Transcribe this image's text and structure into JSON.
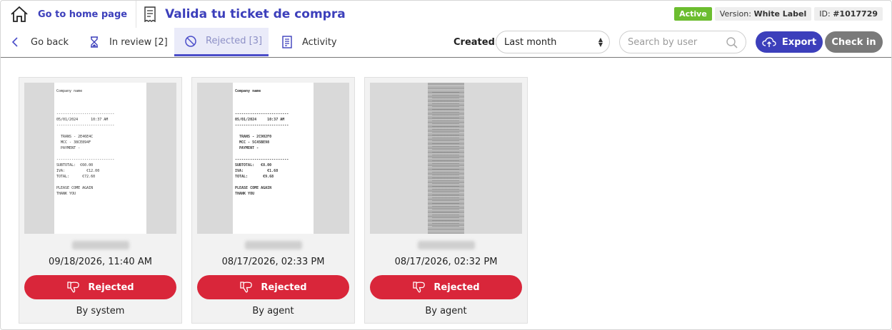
{
  "header": {
    "home_label": "Go to home page",
    "title": "Valida tu ticket de compra",
    "status": "Active",
    "version_label": "Version:",
    "version_value": "White Label",
    "id_label": "ID:",
    "id_value": "#1017729"
  },
  "tabs": {
    "back": "Go back",
    "review": "In review [2]",
    "rejected": "Rejected [3]",
    "activity": "Activity"
  },
  "filters": {
    "created_label": "Created:",
    "created_value": "Last month",
    "search_placeholder": "Search by user"
  },
  "actions": {
    "export": "Export",
    "checkin": "Check in"
  },
  "tickets": [
    {
      "date": "09/18/2026, 11:40 AM",
      "status": "Rejected",
      "by": "By system",
      "receipt_lines": "Company name\n\n\n\n---------------------------\n05/01/2024      10:37 AM\n---------------------------\n\n  TRANS - 2E46E4C\n  MCC - 38CE894F\n  PAYMENT -\n\n---------------------------\nSUBTOTAL:  €60.00\nIVA:          €12.00\nTOTAL:      €72.60\n\nPLEASE COME AGAIN\nTHANK YOU"
    },
    {
      "date": "08/17/2026, 02:33 PM",
      "status": "Rejected",
      "by": "By agent",
      "receipt_lines": "Company name\n\n\n\n-------------------------\n05/01/2024     10:37 AM\n-------------------------\n\n  TRANS - 2C902F0\n  MCC - 5C45BE98\n  PAYMENT -\n\n-------------------------\nSUBTOTAL:   €8.00\nIVA:           €1.68\nTOTAL:       €9.68\n\nPLEASE COME AGAIN\nTHANK YOU"
    },
    {
      "date": "08/17/2026, 02:32 PM",
      "status": "Rejected",
      "by": "By agent"
    }
  ],
  "colors": {
    "brand": "#3c3fbb",
    "active": "#6cbd2f",
    "rejected": "#d9263a",
    "checkin": "#7a7a7a"
  },
  "icons": {
    "home": "home-icon",
    "title": "receipt-icon",
    "back": "chevron-left-icon",
    "review": "hourglass-icon",
    "rejected": "ban-icon",
    "activity": "document-list-icon",
    "search": "search-icon",
    "export": "cloud-upload-icon",
    "reject": "thumbs-down-icon"
  }
}
